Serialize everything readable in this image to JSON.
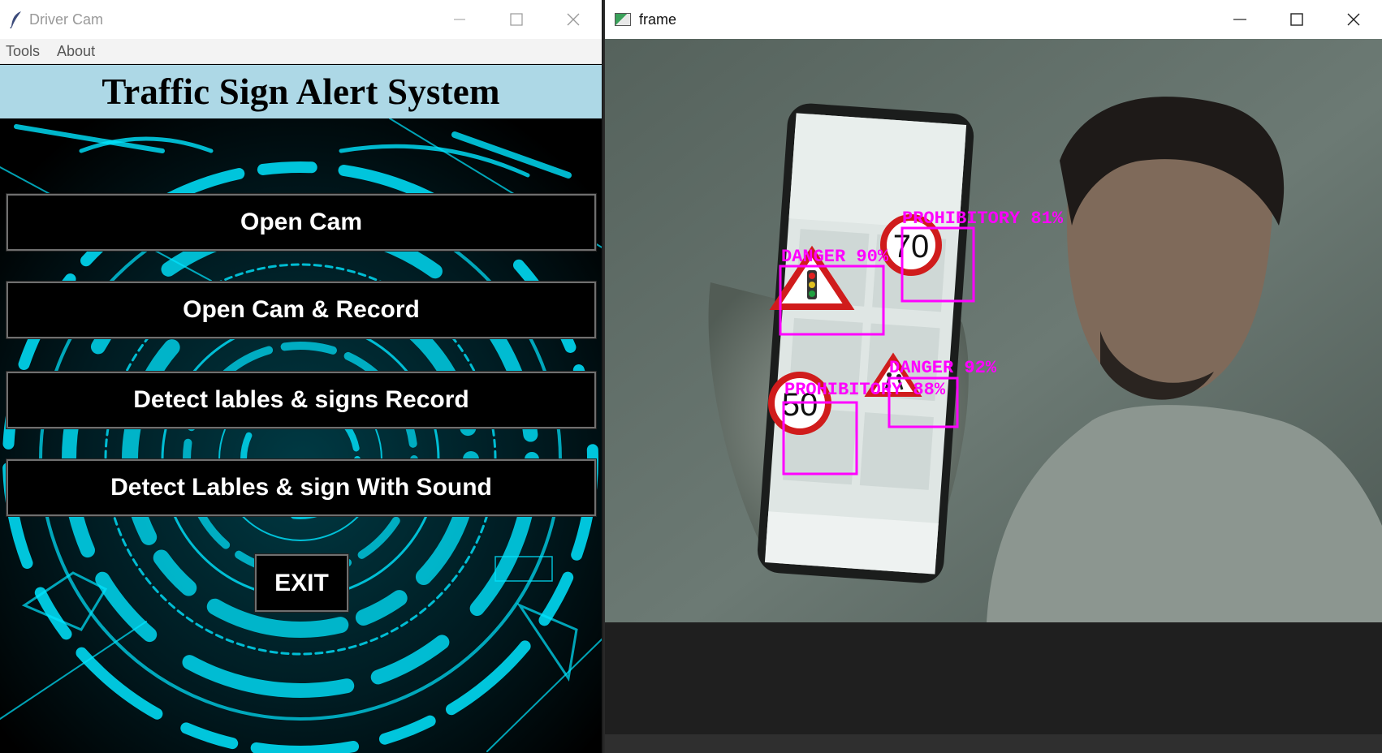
{
  "left_window": {
    "title": "Driver Cam",
    "menu": [
      "Tools",
      "About"
    ],
    "heading": "Traffic Sign Alert System",
    "buttons": {
      "open_cam": "Open Cam",
      "open_cam_record": "Open Cam & Record",
      "detect_record": "Detect lables & signs Record",
      "detect_sound": "Detect Lables & sign With Sound",
      "exit": "EXIT"
    }
  },
  "right_window": {
    "title": "frame",
    "detections": [
      {
        "label": "PROHIBITORY 81%",
        "sign": "70"
      },
      {
        "label": "DANGER 90%",
        "sign": "traffic-light-warning"
      },
      {
        "label": "DANGER 92%",
        "sign": "pedestrian-warning"
      },
      {
        "label": "PROHIBITORY 88%",
        "sign": "50"
      }
    ]
  },
  "colors": {
    "header_band": "#add8e6",
    "cyan_art": "#00e5ff",
    "detection_box": "#ff00ff"
  }
}
